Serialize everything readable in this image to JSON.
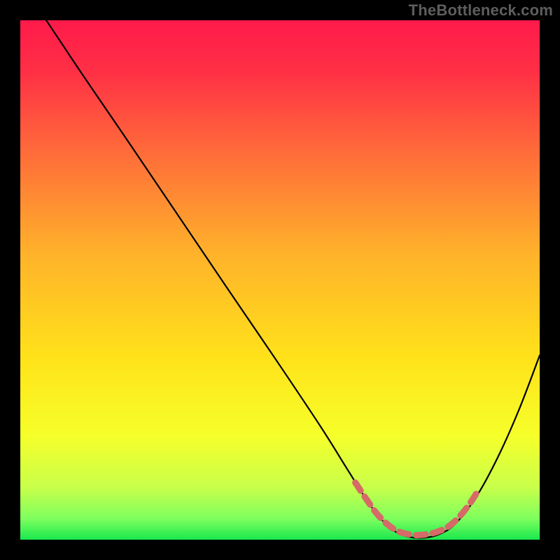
{
  "watermark": "TheBottleneck.com",
  "chart_data": {
    "type": "line",
    "title": "",
    "xlabel": "",
    "ylabel": "",
    "xlim": [
      0,
      100
    ],
    "ylim": [
      0,
      100
    ],
    "gradient_stops": [
      {
        "offset": 0.0,
        "color": "#ff1a4b"
      },
      {
        "offset": 0.1,
        "color": "#ff3045"
      },
      {
        "offset": 0.25,
        "color": "#ff6a3a"
      },
      {
        "offset": 0.45,
        "color": "#ffb22a"
      },
      {
        "offset": 0.65,
        "color": "#ffe21a"
      },
      {
        "offset": 0.8,
        "color": "#f6ff2a"
      },
      {
        "offset": 0.9,
        "color": "#c8ff4a"
      },
      {
        "offset": 0.96,
        "color": "#7dff5e"
      },
      {
        "offset": 1.0,
        "color": "#19e84e"
      }
    ],
    "series": [
      {
        "name": "bottleneck-curve",
        "stroke": "#000000",
        "stroke_width": 2.2,
        "points": [
          {
            "x": 5.0,
            "y": 100.0
          },
          {
            "x": 7.0,
            "y": 97.0
          },
          {
            "x": 12.0,
            "y": 89.5
          },
          {
            "x": 20.0,
            "y": 77.8
          },
          {
            "x": 30.0,
            "y": 63.0
          },
          {
            "x": 40.0,
            "y": 48.2
          },
          {
            "x": 50.0,
            "y": 33.5
          },
          {
            "x": 58.0,
            "y": 21.5
          },
          {
            "x": 63.0,
            "y": 13.5
          },
          {
            "x": 67.0,
            "y": 7.2
          },
          {
            "x": 70.0,
            "y": 3.4
          },
          {
            "x": 72.5,
            "y": 1.4
          },
          {
            "x": 75.0,
            "y": 0.5
          },
          {
            "x": 78.0,
            "y": 0.4
          },
          {
            "x": 81.0,
            "y": 1.2
          },
          {
            "x": 84.0,
            "y": 3.3
          },
          {
            "x": 88.0,
            "y": 8.6
          },
          {
            "x": 92.0,
            "y": 16.0
          },
          {
            "x": 96.0,
            "y": 25.0
          },
          {
            "x": 100.0,
            "y": 35.5
          }
        ]
      }
    ],
    "marker_band": {
      "name": "optimal-band",
      "color": "#d66a68",
      "width": 9,
      "dash": [
        14,
        10
      ],
      "points": [
        {
          "x": 64.5,
          "y": 11.0
        },
        {
          "x": 66.5,
          "y": 8.0
        },
        {
          "x": 69.0,
          "y": 4.6
        },
        {
          "x": 72.0,
          "y": 2.0
        },
        {
          "x": 75.0,
          "y": 1.0
        },
        {
          "x": 78.0,
          "y": 1.0
        },
        {
          "x": 81.0,
          "y": 1.8
        },
        {
          "x": 83.5,
          "y": 3.4
        },
        {
          "x": 86.0,
          "y": 6.2
        },
        {
          "x": 88.0,
          "y": 9.2
        }
      ]
    }
  }
}
